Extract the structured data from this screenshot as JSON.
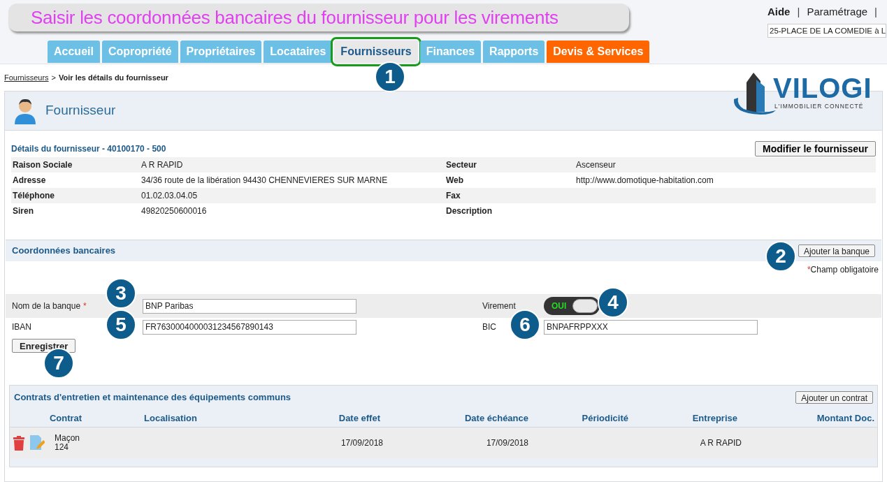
{
  "banner": {
    "title": "Saisir les coordonnées bancaires du fournisseur pour les virements"
  },
  "top_links": [
    {
      "label": "Aide",
      "separator": "|"
    },
    {
      "label": "Paramétrage",
      "separator": "|"
    }
  ],
  "building_select": {
    "value": "25-PLACE DE LA COMEDIE à L"
  },
  "tabs": [
    {
      "label": "Accueil",
      "selected": false,
      "outlined": false,
      "kind": "normal"
    },
    {
      "label": "Copropriété",
      "selected": false,
      "outlined": false,
      "kind": "normal"
    },
    {
      "label": "Propriétaires",
      "selected": false,
      "outlined": false,
      "kind": "normal"
    },
    {
      "label": "Locataires",
      "selected": false,
      "outlined": false,
      "kind": "normal"
    },
    {
      "label": "Fournisseurs",
      "selected": true,
      "outlined": true,
      "kind": "normal"
    },
    {
      "label": "Finances",
      "selected": false,
      "outlined": false,
      "kind": "normal"
    },
    {
      "label": "Rapports",
      "selected": false,
      "outlined": false,
      "kind": "normal"
    },
    {
      "label": "Devis & Services",
      "selected": false,
      "outlined": false,
      "kind": "promo"
    }
  ],
  "breadcrumb": {
    "link": "Fournisseurs",
    "separator": ">",
    "current": "Voir les détails du fournisseur"
  },
  "logo": {
    "name": "VILOGI",
    "tagline": "L'IMMOBILIER CONNECTÉ"
  },
  "panel_title": "Fournisseur",
  "details": {
    "title": "Détails du fournisseur - 40100170 - 500",
    "edit_button": "Modifier le fournisseur",
    "rows": [
      {
        "label": "Raison Sociale",
        "value": "A R RAPID",
        "label_2": "Secteur",
        "value_2": "Ascenseur"
      },
      {
        "label": "Adresse",
        "value": "34/36 route de la libération 94430 CHENNEVIERES SUR MARNE",
        "label_2": "Web",
        "value_2": "http://www.domotique-habitation.com"
      },
      {
        "label": "Téléphone",
        "value": "01.02.03.04.05",
        "label_2": "Fax"
      },
      {
        "label": "Siren",
        "value": "49820250600016",
        "label_2": "Description"
      }
    ]
  },
  "bank": {
    "title": "Coordonnées bancaires",
    "add_button": "Ajouter la banque",
    "required_mark": "*",
    "required_note": "Champ obligatoire",
    "bank_name": {
      "label": "Nom de la banque",
      "required": true,
      "value": "BNP Paribas"
    },
    "transfer": {
      "label": "Virement",
      "on": true,
      "on_text": "OUI"
    },
    "iban": {
      "label": "IBAN",
      "value": "FR7630004000031234567890143"
    },
    "bic": {
      "label": "BIC",
      "value": "BNPAFRPPXXX"
    },
    "save_button": "Enregistrer"
  },
  "contracts": {
    "title": "Contrats d'entretien et maintenance des équipements communs",
    "add_button": "Ajouter un contrat",
    "columns": [
      "Contrat",
      "Localisation",
      "Date effet",
      "Date échéance",
      "Périodicité",
      "Entreprise",
      "Montant Doc."
    ],
    "rows": [
      {
        "contract": "Maçon",
        "contract_number": "124",
        "start_date": "17/09/2018",
        "end_date": "17/09/2018",
        "company": "A R RAPID"
      }
    ]
  },
  "callouts": [
    "1",
    "2",
    "3",
    "4",
    "5",
    "6",
    "7"
  ]
}
